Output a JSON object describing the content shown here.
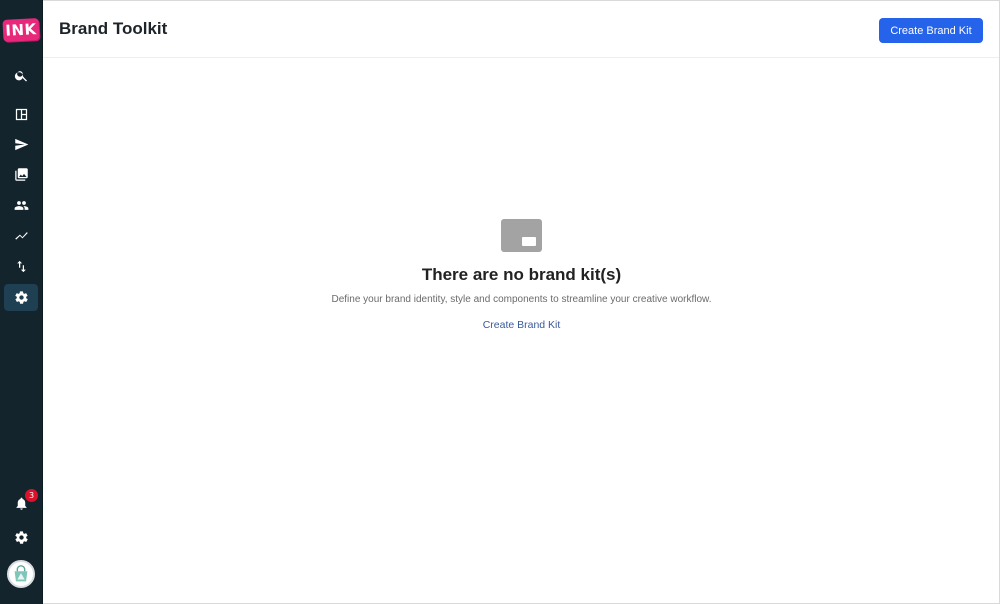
{
  "app": {
    "logo_text": "INK",
    "brand_color": "#e8287b",
    "accent_color": "#2563eb",
    "sidebar_color": "#13242d"
  },
  "sidebar": {
    "items": [
      {
        "icon": "search-icon"
      },
      {
        "icon": "layout-icon"
      },
      {
        "icon": "send-icon"
      },
      {
        "icon": "images-icon"
      },
      {
        "icon": "users-icon"
      },
      {
        "icon": "analytics-icon"
      },
      {
        "icon": "transfer-icon"
      },
      {
        "icon": "gear-icon",
        "active": true
      }
    ],
    "notifications": {
      "icon": "bell-icon",
      "count": "3"
    },
    "settings": {
      "icon": "gear-icon"
    },
    "avatar": {
      "icon": "avatar-icon"
    }
  },
  "header": {
    "title": "Brand Toolkit",
    "create_button": "Create Brand Kit"
  },
  "empty_state": {
    "icon": "image-placeholder-icon",
    "title": "There are no brand kit(s)",
    "description": "Define your brand identity, style and components to streamline your creative workflow.",
    "link": "Create Brand Kit"
  }
}
